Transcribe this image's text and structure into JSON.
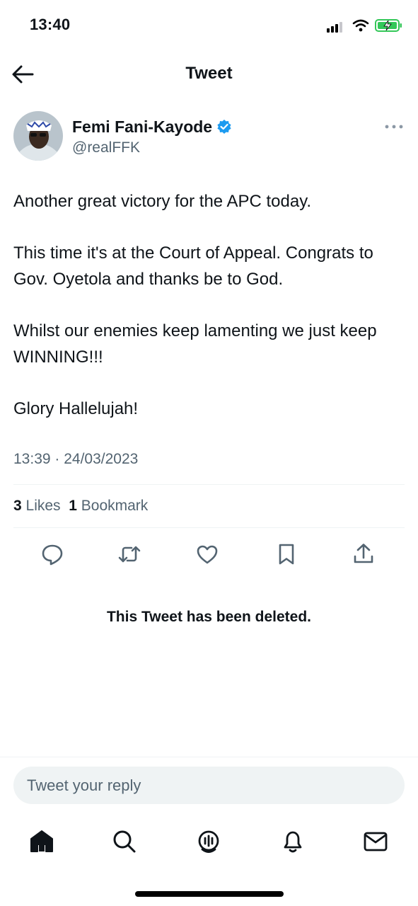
{
  "status_bar": {
    "time": "13:40",
    "icons": [
      "signal-icon",
      "wifi-icon",
      "battery-charging-icon"
    ],
    "battery_color": "#34c759"
  },
  "header": {
    "title": "Tweet",
    "back_icon": "arrow-left-icon"
  },
  "tweet": {
    "author": {
      "name": "Femi Fani-Kayode",
      "handle": "@realFFK",
      "verified_color": "#1d9bf0"
    },
    "paragraphs": [
      "Another great victory for the APC today.",
      "This time it's at the Court of Appeal. Congrats to Gov. Oyetola and thanks be to God.",
      "Whilst our enemies keep lamenting we just keep WINNING!!!",
      "Glory Hallelujah!"
    ],
    "timestamp": "13:39 · 24/03/2023",
    "stats": {
      "likes_count": "3",
      "likes_label": "Likes",
      "bookmarks_count": "1",
      "bookmarks_label": "Bookmark"
    },
    "actions": [
      "reply-icon",
      "retweet-icon",
      "like-icon",
      "bookmark-icon",
      "share-icon"
    ]
  },
  "deleted_notice": "This Tweet has been deleted.",
  "reply": {
    "placeholder": "Tweet your reply"
  },
  "tab_bar": {
    "items": [
      "home-icon",
      "search-icon",
      "spaces-icon",
      "notifications-icon",
      "messages-icon"
    ]
  }
}
